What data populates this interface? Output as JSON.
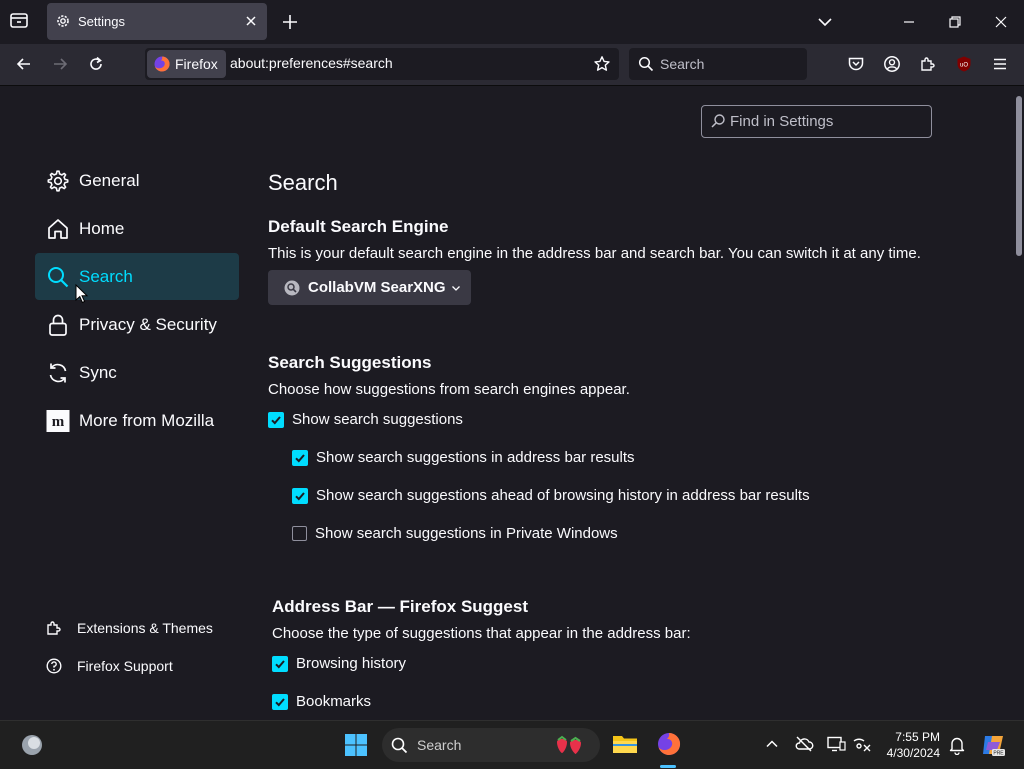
{
  "browser": {
    "tab_title": "Settings",
    "identity_label": "Firefox",
    "url": "about:preferences#search",
    "search_placeholder": "Search"
  },
  "find": {
    "placeholder": "Find in Settings"
  },
  "sidebar": {
    "items": [
      {
        "label": "General",
        "icon": "gear-icon"
      },
      {
        "label": "Home",
        "icon": "home-icon"
      },
      {
        "label": "Search",
        "icon": "search-icon",
        "selected": true
      },
      {
        "label": "Privacy & Security",
        "icon": "lock-icon"
      },
      {
        "label": "Sync",
        "icon": "sync-icon"
      },
      {
        "label": "More from Mozilla",
        "icon": "mozilla-icon"
      }
    ],
    "footer": [
      {
        "label": "Extensions & Themes",
        "icon": "puzzle-icon"
      },
      {
        "label": "Firefox Support",
        "icon": "help-icon"
      }
    ]
  },
  "main": {
    "title": "Search",
    "default_engine": {
      "heading": "Default Search Engine",
      "description": "This is your default search engine in the address bar and search bar. You can switch it at any time.",
      "selected": "CollabVM SearXNG"
    },
    "suggestions": {
      "heading": "Search Suggestions",
      "description": "Choose how suggestions from search engines appear.",
      "show": {
        "label": "Show search suggestions",
        "checked": true
      },
      "address_bar": {
        "label": "Show search suggestions in address bar results",
        "checked": true
      },
      "ahead": {
        "label": "Show search suggestions ahead of browsing history in address bar results",
        "checked": true
      },
      "private": {
        "label": "Show search suggestions in Private Windows",
        "checked": false
      }
    },
    "suggest": {
      "heading": "Address Bar — Firefox Suggest",
      "description": "Choose the type of suggestions that appear in the address bar:",
      "history": {
        "label": "Browsing history",
        "checked": true
      },
      "bookmarks": {
        "label": "Bookmarks",
        "checked": true
      }
    }
  },
  "taskbar": {
    "search_placeholder": "Search",
    "time": "7:55 PM",
    "date": "4/30/2024"
  },
  "colors": {
    "accent": "#00ddff",
    "selected_bg": "#1d3b47",
    "bg": "#1c1b22",
    "toolbar": "#2b2a33"
  }
}
